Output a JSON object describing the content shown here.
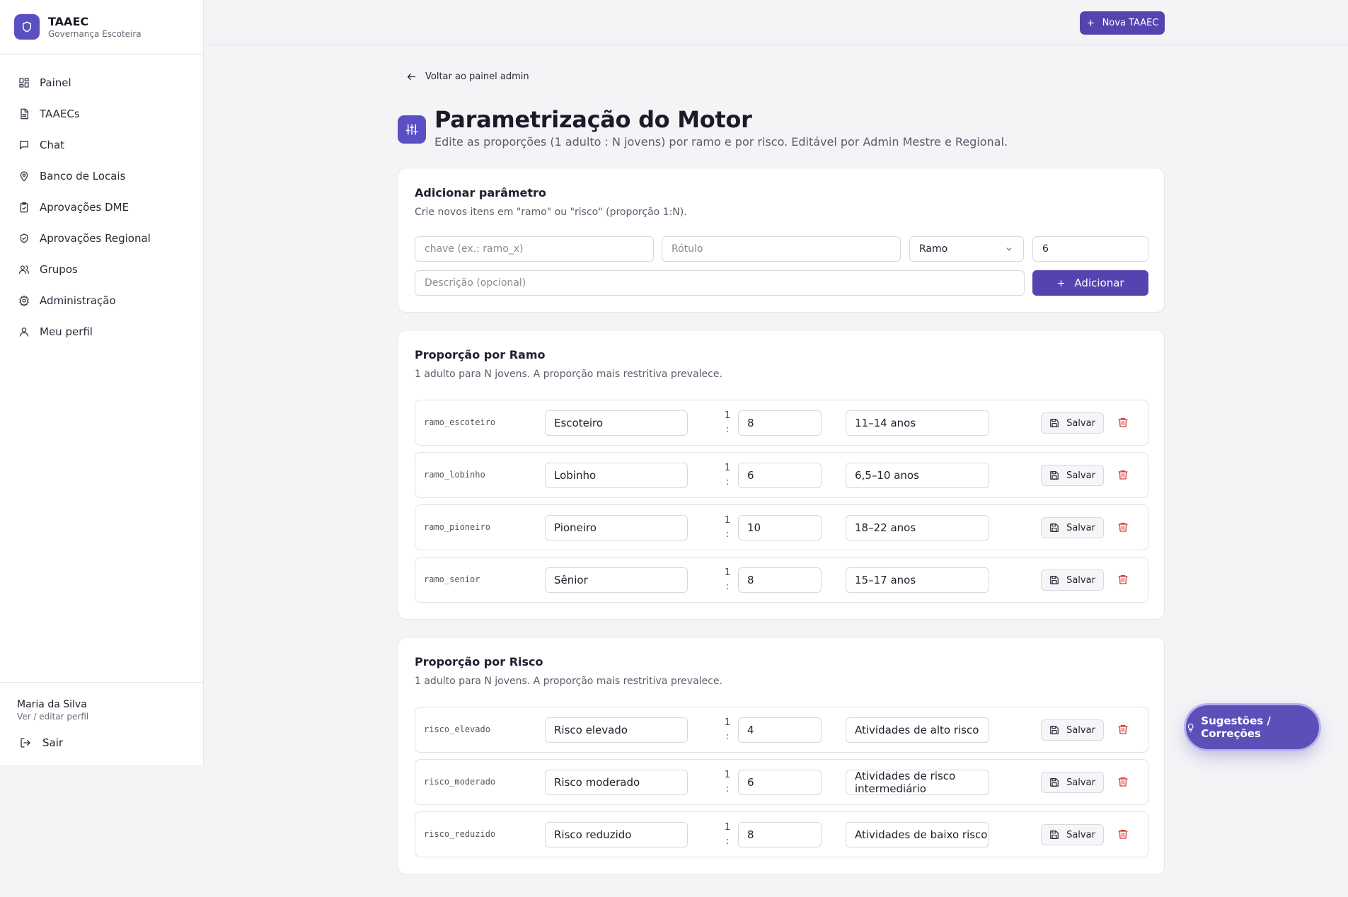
{
  "brand": {
    "title": "TAAEC",
    "subtitle": "Governança Escoteira"
  },
  "sidebar": {
    "items": [
      {
        "label": "Painel",
        "icon": "dashboard-icon"
      },
      {
        "label": "TAAECs",
        "icon": "document-icon"
      },
      {
        "label": "Chat",
        "icon": "chat-icon"
      },
      {
        "label": "Banco de Locais",
        "icon": "map-pin-icon"
      },
      {
        "label": "Aprovações DME",
        "icon": "clipboard-check-icon"
      },
      {
        "label": "Aprovações Regional",
        "icon": "shield-check-icon"
      },
      {
        "label": "Grupos",
        "icon": "users-icon"
      },
      {
        "label": "Administração",
        "icon": "gear-icon"
      },
      {
        "label": "Meu perfil",
        "icon": "user-icon"
      }
    ],
    "user_name": "Maria da Silva",
    "user_link": "Ver / editar perfil",
    "logout_label": "Sair"
  },
  "topbar": {
    "new_button": "Nova TAAEC"
  },
  "back_label": "Voltar ao painel admin",
  "page": {
    "title": "Parametrização do Motor",
    "subtitle": "Edite as proporções (1 adulto : N jovens) por ramo e por risco. Editável por Admin Mestre e Regional."
  },
  "add_card": {
    "title": "Adicionar parâmetro",
    "subtitle": "Crie novos itens em \"ramo\" ou \"risco\" (proporção 1:N).",
    "key_placeholder": "chave (ex.: ramo_x)",
    "label_placeholder": "Rótulo",
    "type_value": "Ramo",
    "n_value": "6",
    "desc_placeholder": "Descrição (opcional)",
    "add_button": "Adicionar"
  },
  "ramo_card": {
    "title": "Proporção por Ramo",
    "subtitle": "1 adulto para N jovens. A proporção mais restritiva prevalece.",
    "rows": [
      {
        "key": "ramo_escoteiro",
        "label": "Escoteiro",
        "n": "8",
        "desc": "11–14 anos"
      },
      {
        "key": "ramo_lobinho",
        "label": "Lobinho",
        "n": "6",
        "desc": "6,5–10 anos"
      },
      {
        "key": "ramo_pioneiro",
        "label": "Pioneiro",
        "n": "10",
        "desc": "18–22 anos"
      },
      {
        "key": "ramo_senior",
        "label": "Sênior",
        "n": "8",
        "desc": "15–17 anos"
      }
    ]
  },
  "risco_card": {
    "title": "Proporção por Risco",
    "subtitle": "1 adulto para N jovens. A proporção mais restritiva prevalece.",
    "rows": [
      {
        "key": "risco_elevado",
        "label": "Risco elevado",
        "n": "4",
        "desc": "Atividades de alto risco"
      },
      {
        "key": "risco_moderado",
        "label": "Risco moderado",
        "n": "6",
        "desc": "Atividades de risco intermediário"
      },
      {
        "key": "risco_reduzido",
        "label": "Risco reduzido",
        "n": "8",
        "desc": "Atividades de baixo risco"
      }
    ]
  },
  "ratio_one": "1",
  "ratio_sep": ":",
  "save_label": "Salvar",
  "fab_label": "Sugestões / Correções",
  "colors": {
    "accent": "#5544b0",
    "danger": "#d33a3a"
  }
}
